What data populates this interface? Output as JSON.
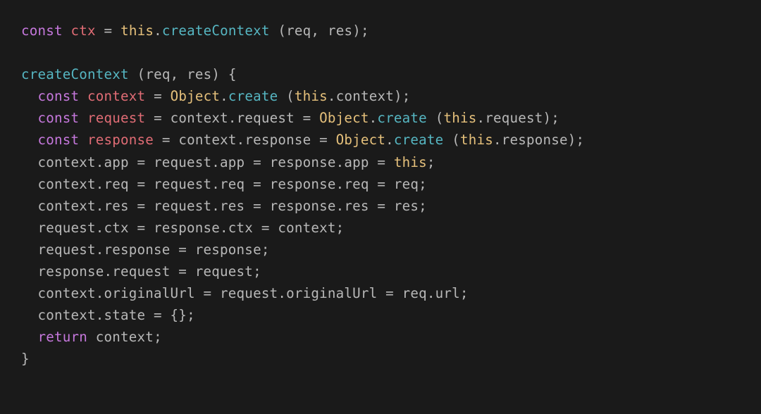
{
  "code": {
    "t1_const": "const",
    "t1_ctx": "ctx",
    "t1_eq": " = ",
    "t1_this": "this",
    "t1_dot": ".",
    "t1_create": "createContext",
    "t1_sp": " ",
    "t1_lp": "(",
    "t1_req": "req",
    "t1_comma": ", ",
    "t1_res": "res",
    "t1_rp": ")",
    "t1_semi": ";",
    "t2_fn": "createContext",
    "t2_sp": " ",
    "t2_lp": "(",
    "t2_req": "req",
    "t2_comma": ", ",
    "t2_res": "res",
    "t2_rp": ")",
    "t2_sp2": " ",
    "t2_lb": "{",
    "indent": "  ",
    "l3_const": "const",
    "l3_context": "context",
    "l3_eq": " = ",
    "l3_obj": "Object",
    "l3_dot": ".",
    "l3_create": "create",
    "l3_sp": " ",
    "l3_lp": "(",
    "l3_this": "this",
    "l3_dot2": ".",
    "l3_ctx": "context",
    "l3_rp": ")",
    "l3_semi": ";",
    "l4_const": "const",
    "l4_request": "request",
    "l4_eq": " = ",
    "l4_context": "context",
    "l4_dot": ".",
    "l4_req": "request",
    "l4_eq2": " = ",
    "l4_obj": "Object",
    "l4_dot2": ".",
    "l4_create": "create",
    "l4_sp": " ",
    "l4_lp": "(",
    "l4_this": "this",
    "l4_dot3": ".",
    "l4_req2": "request",
    "l4_rp": ")",
    "l4_semi": ";",
    "l5_const": "const",
    "l5_response": "response",
    "l5_eq": " = ",
    "l5_context": "context",
    "l5_dot": ".",
    "l5_resp": "response",
    "l5_eq2": " = ",
    "l5_obj": "Object",
    "l5_dot2": ".",
    "l5_create": "create",
    "l5_sp": " ",
    "l5_lp": "(",
    "l5_this": "this",
    "l5_dot3": ".",
    "l5_resp2": "response",
    "l5_rp": ")",
    "l5_semi": ";",
    "l6": "context.app = request.app = response.app = ",
    "l6_this": "this",
    "l6_semi": ";",
    "l7": "context.req = request.req = response.req = req;",
    "l8": "context.res = request.res = response.res = res;",
    "l9": "request.ctx = response.ctx = context;",
    "l10": "request.response = response;",
    "l11": "response.request = request;",
    "l12": "context.originalUrl = request.originalUrl = req.url;",
    "l13a": "context.state = ",
    "l13b": "{}",
    "l13c": ";",
    "l14_return": "return",
    "l14_sp": " ",
    "l14_ctx": "context",
    "l14_semi": ";",
    "l15_rb": "}"
  }
}
